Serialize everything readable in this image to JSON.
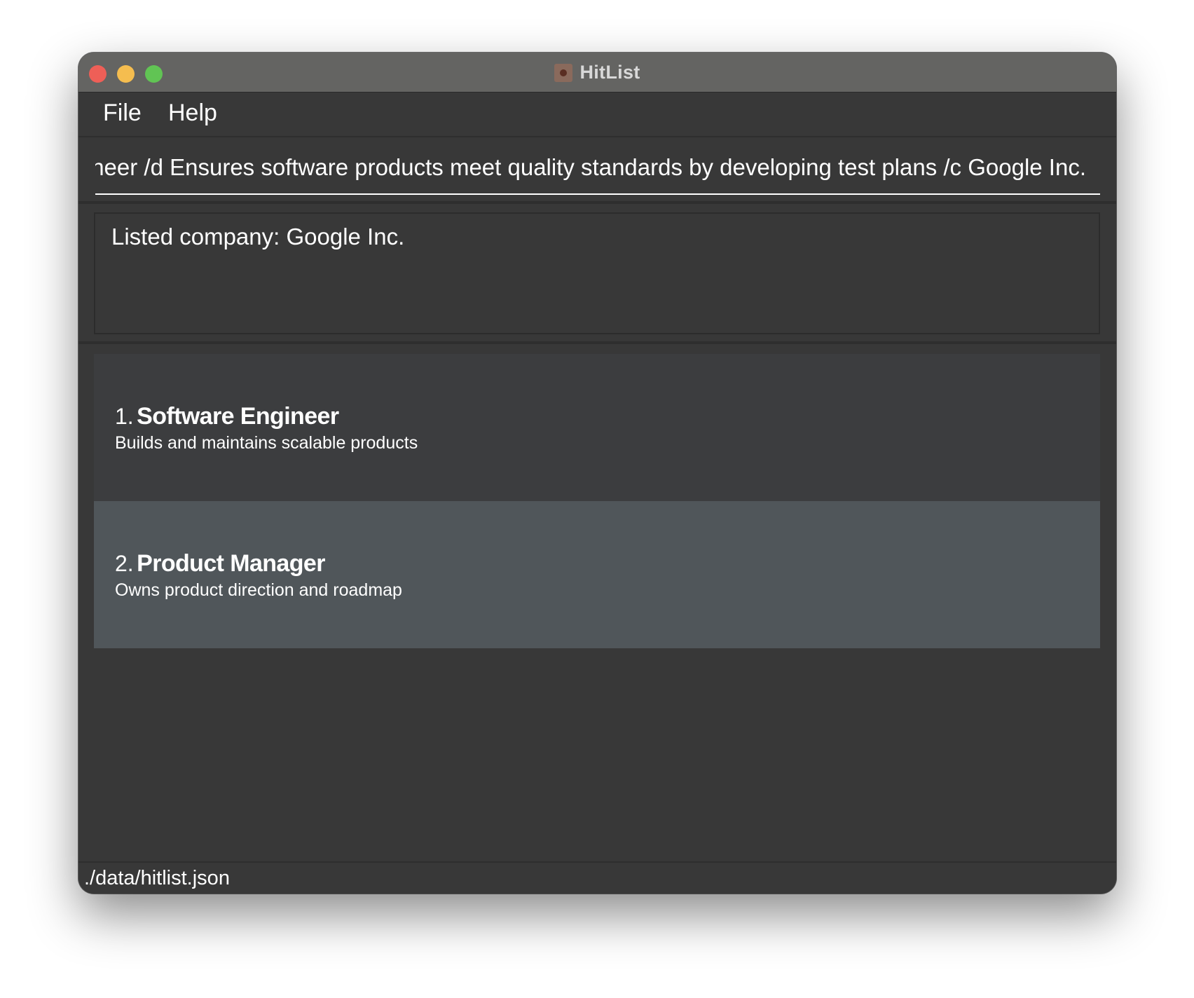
{
  "window": {
    "title": "HitList",
    "app_icon": "hitlist-app-icon"
  },
  "menu": {
    "file_label": "File",
    "help_label": "Help"
  },
  "command": {
    "value": "ineer /d Ensures software products meet quality standards by developing test plans /c Google Inc."
  },
  "result": {
    "message": "Listed company: Google Inc."
  },
  "roles": [
    {
      "index": "1.",
      "title": "Software Engineer",
      "description": "Builds and maintains scalable products"
    },
    {
      "index": "2.",
      "title": "Product Manager",
      "description": "Owns product direction and roadmap"
    }
  ],
  "status": {
    "file_path": "./data/hitlist.json"
  },
  "colors": {
    "close": "#ee5f57",
    "minimize": "#f5bd4f",
    "maximize": "#61c454",
    "background": "#383838",
    "selected_row": "#50565a"
  }
}
